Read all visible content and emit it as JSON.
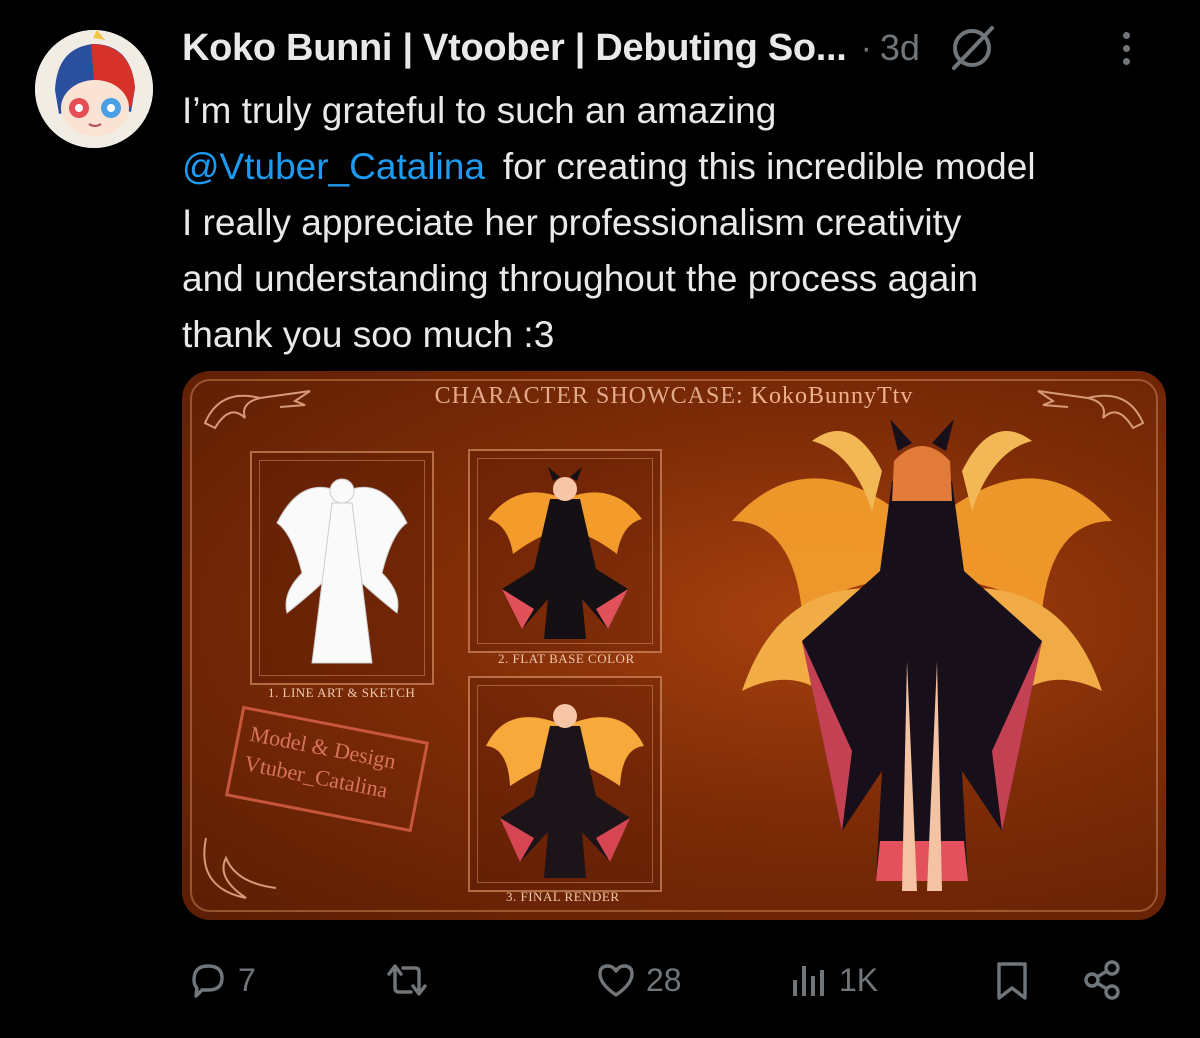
{
  "tweet": {
    "author_name": "Koko Bunni | Vtoober | Debuting So...",
    "separator": "·",
    "time": "3d",
    "text_lines": [
      {
        "text": "I’m truly grateful to such an amazing"
      },
      {
        "mention": "@Vtuber_Catalina",
        "text": "for creating this incredible model"
      },
      {
        "text": "I really appreciate her professionalism creativity"
      },
      {
        "text": "and understanding throughout the process again"
      },
      {
        "text": "thank you soo much :3"
      }
    ]
  },
  "media": {
    "title_prefix": "Character Showcase:",
    "title_handle": "KokoBunnyTtv",
    "panels": [
      {
        "caption": "1. LINE ART & SKETCH"
      },
      {
        "caption": "2. FLAT BASE COLOR"
      },
      {
        "caption": "3. FINAL RENDER"
      }
    ],
    "stamp_lines": [
      "Model & Design",
      "Vtuber_Catalina"
    ],
    "colors": {
      "background": "#7e2c07",
      "accent": "#f39c2c",
      "fur": "#f5a623"
    }
  },
  "actions": {
    "reply_count": "7",
    "repost_count": "",
    "like_count": "28",
    "views_count": "1K"
  },
  "icons": [
    "grok-icon",
    "more-icon",
    "reply-icon",
    "repost-icon",
    "like-icon",
    "views-icon",
    "bookmark-icon",
    "share-icon"
  ],
  "theme": {
    "text": "#e7e9ea",
    "muted": "#71767b",
    "link": "#1d9bf0",
    "background": "#000000"
  }
}
